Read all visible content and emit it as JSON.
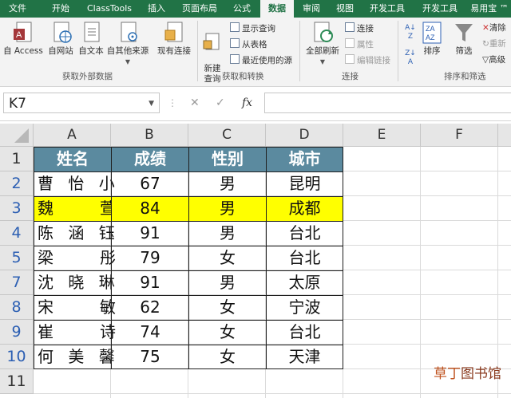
{
  "ribbon_tabs": [
    "文件",
    "开始",
    "ClassTools",
    "插入",
    "页面布局",
    "公式",
    "数据",
    "审阅",
    "视图",
    "开发工具",
    "开发工具",
    "易用宝 ™"
  ],
  "active_tab": "数据",
  "ribbon": {
    "get_external": {
      "buttons": [
        "自 Access",
        "自网站",
        "自文本",
        "自其他来源",
        "现有连接"
      ],
      "label": "获取外部数据"
    },
    "get_transform": {
      "new_query": "新建\n查询",
      "small": [
        "显示查询",
        "从表格",
        "最近使用的源"
      ],
      "label": "获取和转换"
    },
    "connections": {
      "refresh_all": "全部刷新",
      "small": [
        "连接",
        "属性",
        "编辑链接"
      ],
      "label": "连接"
    },
    "sort_filter": {
      "sort": "排序",
      "filter": "筛选",
      "small": [
        "清除",
        "重新",
        "高级"
      ],
      "label": "排序和筛选"
    }
  },
  "name_box": "K7",
  "formula_buttons": {
    "cancel": "✕",
    "enter": "✓",
    "fx": "fx"
  },
  "formula_value": "",
  "columns": [
    "A",
    "B",
    "C",
    "D",
    "E",
    "F"
  ],
  "rows": [
    "1",
    "2",
    "3",
    "4",
    "5",
    "6",
    "7",
    "8",
    "9",
    "10",
    "11"
  ],
  "table": {
    "headers": [
      "姓名",
      "成绩",
      "性别",
      "城市"
    ],
    "rows": [
      [
        "曹 怡 小",
        "67",
        "男",
        "昆明"
      ],
      [
        "魏　　萱",
        "84",
        "男",
        "成都"
      ],
      [
        "陈 涵 钰",
        "91",
        "男",
        "台北"
      ],
      [
        "梁　　彤",
        "79",
        "女",
        "台北"
      ],
      [
        "沈 晓 琳",
        "91",
        "男",
        "太原"
      ],
      [
        "宋　　敏",
        "62",
        "女",
        "宁波"
      ],
      [
        "崔　　诗",
        "74",
        "女",
        "台北"
      ],
      [
        "何 美 馨",
        "75",
        "女",
        "天津"
      ]
    ],
    "highlight_row_index": 1,
    "highlight_color": "#ffff00",
    "header_color": "#5b8a9f"
  },
  "watermark": {
    "left": "草丁",
    "right": "图书馆"
  },
  "colors": {
    "ribbon_green": "#217346"
  }
}
